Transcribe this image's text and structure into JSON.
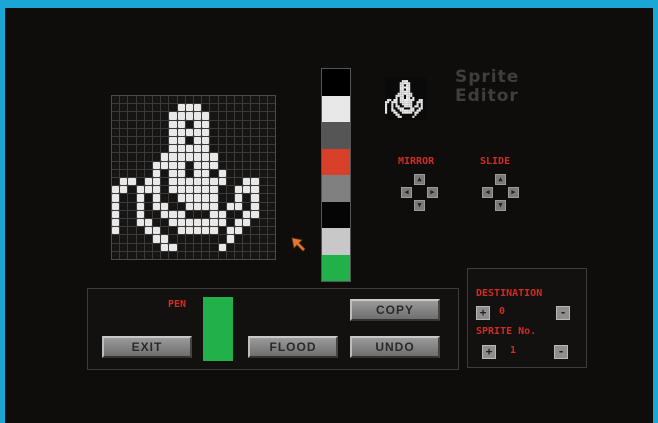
{
  "app": {
    "title_line1": "Sprite",
    "title_line2": "Editor"
  },
  "colors": {
    "background_border": "#1aa7d6",
    "screen": "#0e0d0c",
    "label_red": "#d42a22",
    "pixel_on": "#e8e8e8"
  },
  "sprite": {
    "width": 20,
    "height": 20,
    "rows": [
      "....................",
      "........###.........",
      ".......#####........",
      ".......##.##........",
      ".......#####........",
      ".......##.##........",
      ".......#####........",
      "......#######.......",
      ".....####.###.......",
      ".....#.##.##.#......",
      ".##.##.#######..##..",
      "##.###.######..###..",
      "#..#.#..#####..#.#..",
      "#..#.##..####.##.#..",
      "#..#..###...##..##..",
      "#..##..#######.##...",
      "#...##..#####.##....",
      ".....##.......#.....",
      "......##.....#......",
      "...................."
    ]
  },
  "palette": [
    "#000000",
    "#e8e8e8",
    "#555555",
    "#d8402a",
    "#808080",
    "#050505",
    "#c8c8c8",
    "#22b04a"
  ],
  "mirror": {
    "label": "MIRROR",
    "icon": "arrow-pad"
  },
  "slide": {
    "label": "SLIDE",
    "icon": "arrow-pad"
  },
  "pen": {
    "label": "PEN",
    "color": "#22b04a"
  },
  "buttons": {
    "exit": "EXIT",
    "flood": "FLOOD",
    "copy": "COPY",
    "undo": "UNDO"
  },
  "destination": {
    "label": "DESTINATION",
    "value": "0",
    "plus": "+",
    "minus": "-"
  },
  "sprite_no": {
    "label": "SPRITE No.",
    "value": "1",
    "plus": "+",
    "minus": "-"
  },
  "cursor": {
    "icon": "arrow-pointer-icon",
    "color": "#e07a30"
  }
}
